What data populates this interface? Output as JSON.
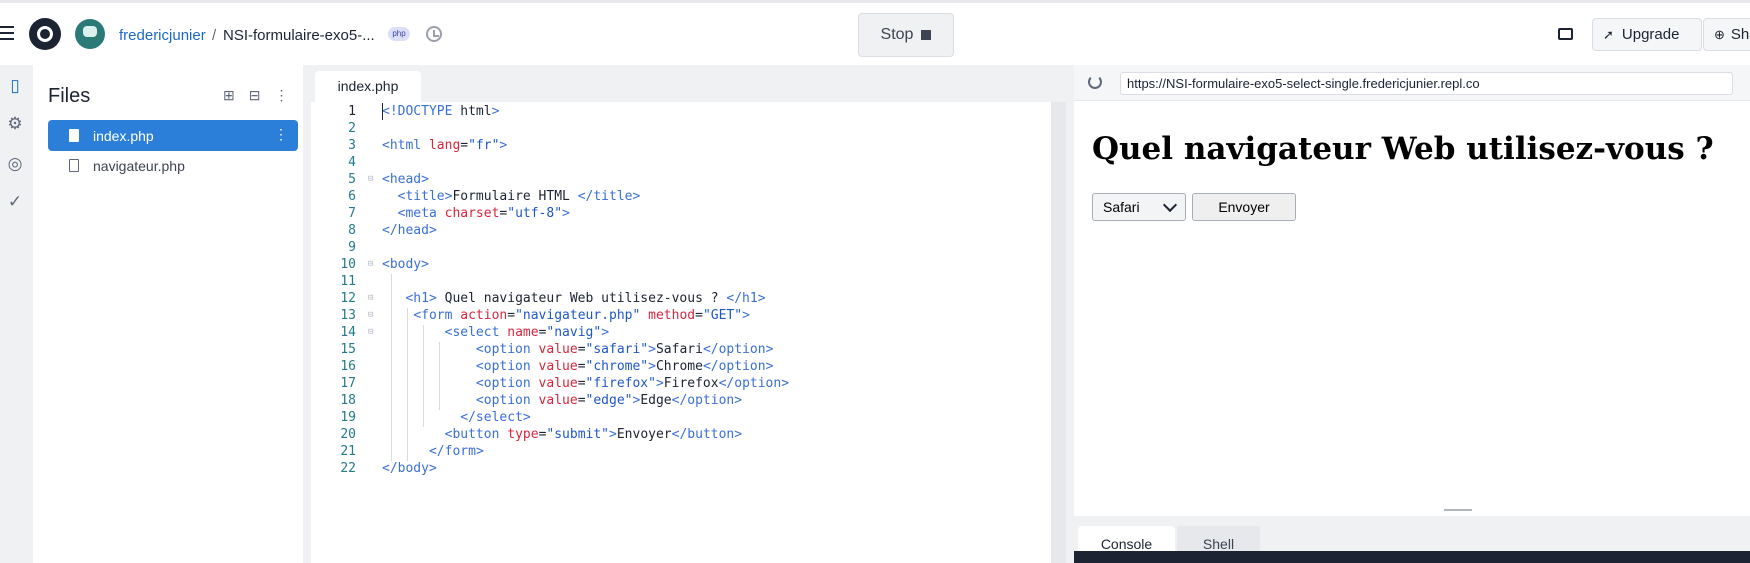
{
  "header": {
    "user": "fredericjunier",
    "separator": "/",
    "repl_name": "NSI-formulaire-exo5-...",
    "language_badge": "php",
    "stop_label": "Stop",
    "upgrade_label": "Upgrade",
    "share_label": "Sha"
  },
  "files": {
    "title": "Files",
    "items": [
      {
        "name": "index.php",
        "active": true
      },
      {
        "name": "navigateur.php",
        "active": false
      }
    ]
  },
  "editor": {
    "tab": "index.php",
    "lines": [
      {
        "n": "1",
        "code": "<!DOCTYPE html>"
      },
      {
        "n": "2",
        "code": ""
      },
      {
        "n": "3",
        "code": "<html lang=\"fr\">"
      },
      {
        "n": "4",
        "code": ""
      },
      {
        "n": "5",
        "code": "<head>"
      },
      {
        "n": "6",
        "code": "  <title>Formulaire HTML </title>"
      },
      {
        "n": "7",
        "code": "  <meta charset=\"utf-8\">"
      },
      {
        "n": "8",
        "code": "</head>"
      },
      {
        "n": "9",
        "code": ""
      },
      {
        "n": "10",
        "code": "<body>"
      },
      {
        "n": "11",
        "code": ""
      },
      {
        "n": "12",
        "code": "   <h1> Quel navigateur Web utilisez-vous ? </h1>"
      },
      {
        "n": "13",
        "code": "    <form action=\"navigateur.php\" method=\"GET\">"
      },
      {
        "n": "14",
        "code": "        <select name=\"navig\">"
      },
      {
        "n": "15",
        "code": "            <option value=\"safari\">Safari</option>"
      },
      {
        "n": "16",
        "code": "            <option value=\"chrome\">Chrome</option>"
      },
      {
        "n": "17",
        "code": "            <option value=\"firefox\">Firefox</option>"
      },
      {
        "n": "18",
        "code": "            <option value=\"edge\">Edge</option>"
      },
      {
        "n": "19",
        "code": "          </select>"
      },
      {
        "n": "20",
        "code": "        <button type=\"submit\">Envoyer</button>"
      },
      {
        "n": "21",
        "code": "      </form>"
      },
      {
        "n": "22",
        "code": "</body>"
      }
    ]
  },
  "webview": {
    "url": "https://NSI-formulaire-exo5-select-single.fredericjunier.repl.co",
    "heading": "Quel navigateur Web utilisez-vous ?",
    "select_value": "Safari",
    "submit_label": "Envoyer"
  },
  "console": {
    "tabs": [
      "Console",
      "Shell"
    ]
  },
  "colors": {
    "accent": "#2b7fd9",
    "link": "#1b6ac9",
    "tag": "#3a6fd8",
    "attr": "#d7263d",
    "string": "#1f57c8"
  },
  "icons": [
    "menu-icon",
    "replit-logo",
    "user-avatar",
    "history-icon",
    "stop-icon",
    "chat-icon",
    "rocket-icon",
    "add-user-icon",
    "file-icon",
    "settings-icon",
    "database-icon",
    "check-icon",
    "new-file-icon",
    "new-folder-icon",
    "kebab-icon",
    "reload-icon",
    "chevron-down-icon"
  ]
}
